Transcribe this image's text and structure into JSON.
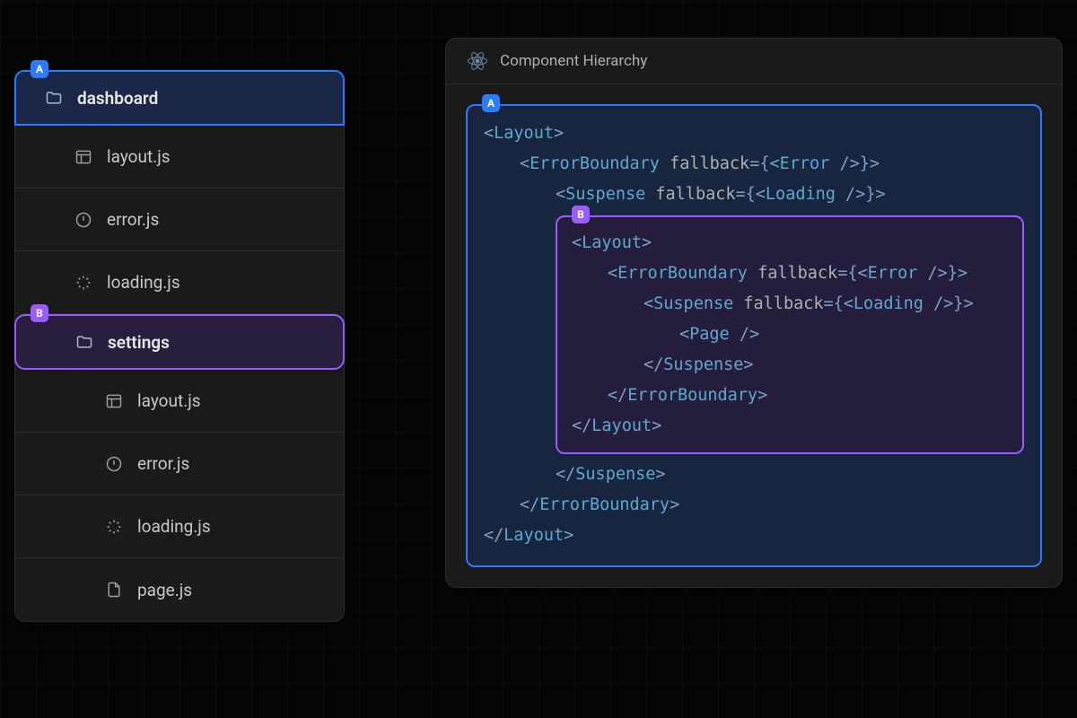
{
  "fileTree": {
    "badgeA": "A",
    "badgeB": "B",
    "folderA": "dashboard",
    "folderB": "settings",
    "filesA": [
      "layout.js",
      "error.js",
      "loading.js"
    ],
    "filesB": [
      "layout.js",
      "error.js",
      "loading.js",
      "page.js"
    ]
  },
  "hierarchy": {
    "title": "Component Hierarchy",
    "badgeA": "A",
    "badgeB": "B",
    "components": {
      "layout": "Layout",
      "errorBoundary": "ErrorBoundary",
      "suspense": "Suspense",
      "page": "Page",
      "error": "Error",
      "loading": "Loading"
    },
    "attr": "fallback"
  }
}
